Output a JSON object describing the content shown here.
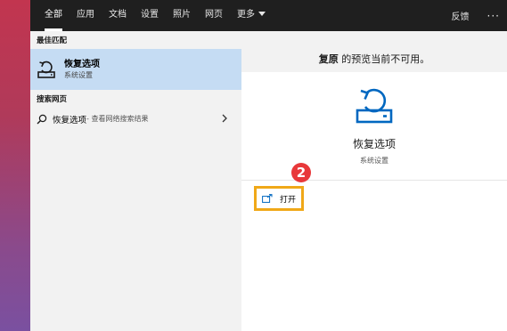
{
  "tabs": [
    {
      "label": "全部",
      "active": true
    },
    {
      "label": "应用"
    },
    {
      "label": "文档"
    },
    {
      "label": "设置"
    },
    {
      "label": "照片"
    },
    {
      "label": "网页"
    },
    {
      "label": "更多"
    }
  ],
  "topbar": {
    "feedback": "反馈",
    "more": "···"
  },
  "results": {
    "best_match_header": "最佳匹配",
    "best_match": {
      "name": "恢复选项",
      "subtitle": "系统设置",
      "icon": "restore-icon"
    },
    "web_header": "搜索网页",
    "web_item": {
      "label": "恢复选项",
      "hint": " - 查看网络搜索结果",
      "icon": "search-icon"
    }
  },
  "preview": {
    "header_bold": "复原",
    "header_rest": " 的预览当前不可用。",
    "app_title": "恢复选项",
    "app_subtitle": "系统设置",
    "open_label": "打开",
    "annotation_number": "2"
  },
  "colors": {
    "topbar": "#1f1f1f",
    "selection": "#c5dcf3",
    "accent_icon": "#0067c0",
    "highlight_box": "#f0a818",
    "annotation_badge": "#e8383a"
  }
}
